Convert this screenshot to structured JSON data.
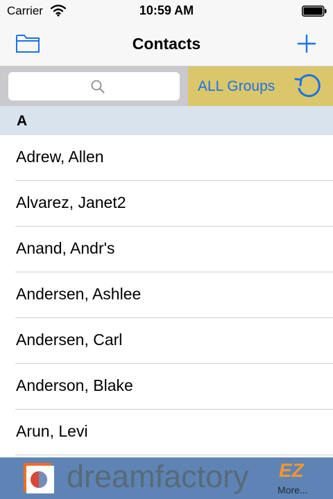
{
  "status": {
    "carrier": "Carrier",
    "time": "10:59 AM"
  },
  "nav": {
    "title": "Contacts"
  },
  "search": {
    "placeholder": ""
  },
  "groups": {
    "label": "ALL Groups"
  },
  "section": {
    "letter": "A"
  },
  "contacts": [
    "Adrew, Allen",
    "Alvarez, Janet2",
    "Anand, Andr's",
    "Andersen, Ashlee",
    "Andersen, Carl",
    "Anderson, Blake",
    "Arun, Levi"
  ],
  "ad": {
    "brand": "dreamfactory",
    "badge": "EZ",
    "more": "More..."
  },
  "colors": {
    "accent": "#1a73e8",
    "groups_bg": "#dcc66a",
    "section_bg": "#d8e3ee",
    "ad_bg": "#5e84b5"
  }
}
